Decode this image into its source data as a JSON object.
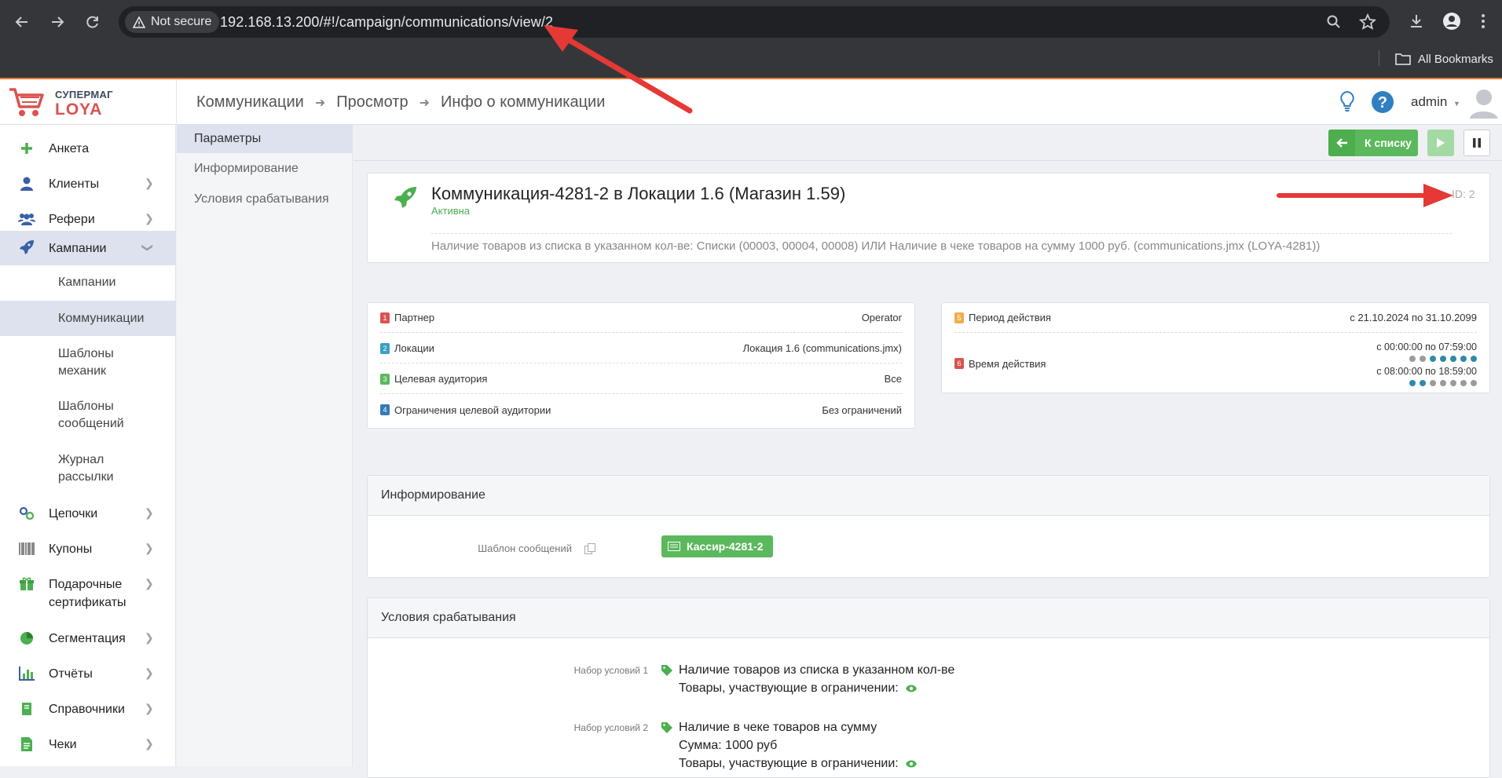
{
  "browser": {
    "security_label": "Not secure",
    "url": "192.168.13.200/#!/campaign/communications/view/2",
    "bookmarks_label": "All Bookmarks"
  },
  "app": {
    "logo_top": "СУПЕРМАГ",
    "logo_bottom": "LOYA",
    "breadcrumbs": [
      "Коммуникации",
      "Просмотр",
      "Инфо о коммуникации"
    ],
    "user": "admin"
  },
  "sidebar": {
    "items": [
      {
        "label": "Анкета",
        "icon": "plus-icon"
      },
      {
        "label": "Клиенты",
        "icon": "user-icon"
      },
      {
        "label": "Рефери",
        "icon": "users-icon"
      },
      {
        "label": "Кампании",
        "icon": "rocket-icon"
      },
      {
        "label": "Цепочки",
        "icon": "chain-icon"
      },
      {
        "label": "Купоны",
        "icon": "barcode-icon"
      },
      {
        "label": "Подарочные сертификаты",
        "icon": "gift-icon"
      },
      {
        "label": "Сегментация",
        "icon": "pie-chart-icon"
      },
      {
        "label": "Отчёты",
        "icon": "bar-chart-icon"
      },
      {
        "label": "Справочники",
        "icon": "book-icon"
      },
      {
        "label": "Чеки",
        "icon": "receipt-icon"
      }
    ],
    "campaign_sub": [
      "Кампании",
      "Коммуникации",
      "Шаблоны механик",
      "Шаблоны сообщений",
      "Журнал рассылки"
    ]
  },
  "subnav": [
    "Параметры",
    "Информирование",
    "Условия срабатывания"
  ],
  "toolbar": {
    "back_label": "К списку"
  },
  "communication": {
    "title": "Коммуникация-4281-2 в Локации 1.6 (Магазин 1.59)",
    "status": "Активна",
    "id_label": "ID: 2",
    "description": "Наличие товаров из списка в указанном кол-ве: Списки (00003, 00004, 00008) ИЛИ Наличие в чеке товаров на сумму 1000 руб. (communications.jmx (LOYA-4281))"
  },
  "params_left": [
    {
      "num": "1",
      "label": "Партнер",
      "value": "Operator",
      "color": "#d9534f"
    },
    {
      "num": "2",
      "label": "Локации",
      "value": "Локация 1.6 (communications.jmx)",
      "color": "#3aa0c4"
    },
    {
      "num": "3",
      "label": "Целевая аудитория",
      "value": "Все",
      "color": "#5cb85c"
    },
    {
      "num": "4",
      "label": "Ограничения целевой аудитории",
      "value": "Без ограничений",
      "color": "#337ab7"
    }
  ],
  "params_right": {
    "period": {
      "num": "5",
      "label": "Период действия",
      "value": "с 21.10.2024 по 31.10.2099",
      "color": "#f0ad4e"
    },
    "time": {
      "num": "6",
      "label": "Время действия",
      "color": "#d9534f",
      "slots": [
        {
          "range": "с 00:00:00 по 07:59:00",
          "days": [
            false,
            false,
            true,
            true,
            true,
            true,
            true
          ]
        },
        {
          "range": "с 08:00:00 по 18:59:00",
          "days": [
            true,
            true,
            false,
            false,
            false,
            false,
            false
          ]
        }
      ]
    }
  },
  "informing": {
    "heading": "Информирование",
    "template_label": "Шаблон сообщений",
    "template_button": "Кассир-4281-2"
  },
  "conditions": {
    "heading": "Условия срабатывания",
    "sets": [
      {
        "label": "Набор условий 1",
        "lines": [
          "Наличие товаров из списка в указанном кол-ве",
          "Товары, участвующие в ограничении:"
        ]
      },
      {
        "label": "Набор условий 2",
        "lines": [
          "Наличие в чеке товаров на сумму",
          "Сумма: 1000 руб",
          "Товары, участвующие в ограничении:"
        ]
      }
    ]
  },
  "colors": {
    "accent_green": "#5cb85c",
    "arrow_red": "#e53935",
    "browser_bg": "#35363a"
  }
}
